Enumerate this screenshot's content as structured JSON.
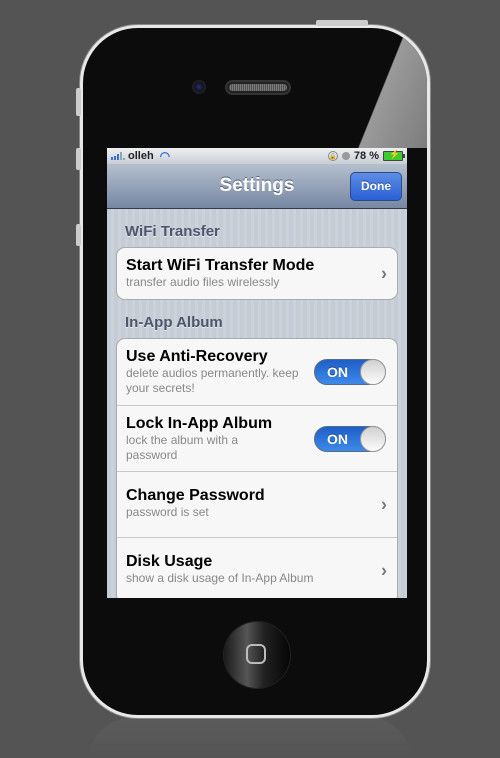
{
  "statusbar": {
    "carrier": "olleh",
    "battery_text": "78 %",
    "battery_level": 0.78,
    "icons": [
      "signal-icon",
      "wifi-icon",
      "rotation-lock-icon",
      "alarm-icon",
      "battery-charging-icon"
    ]
  },
  "navbar": {
    "title": "Settings",
    "done_label": "Done"
  },
  "sections": [
    {
      "header": "WiFi Transfer",
      "cells": [
        {
          "title": "Start WiFi Transfer Mode",
          "subtitle": "transfer audio files wirelessly",
          "accessory": "chevron"
        }
      ]
    },
    {
      "header": "In-App Album",
      "cells": [
        {
          "title": "Use Anti-Recovery",
          "subtitle": "delete audios permanently. keep your secrets!",
          "accessory": "toggle",
          "toggle_label": "ON",
          "toggle_on": true
        },
        {
          "title": "Lock In-App Album",
          "subtitle": "lock the album with a password",
          "accessory": "toggle",
          "toggle_label": "ON",
          "toggle_on": true
        },
        {
          "title": "Change Password",
          "subtitle": "password is set",
          "accessory": "chevron"
        },
        {
          "title": "Disk Usage",
          "subtitle": "show a disk usage of In-App Album",
          "accessory": "chevron"
        }
      ]
    }
  ],
  "colors": {
    "toggle_on": "#2a6fd8",
    "navbar": "#7687a3",
    "done_button": "#2a5fd5",
    "background": "#545454"
  }
}
